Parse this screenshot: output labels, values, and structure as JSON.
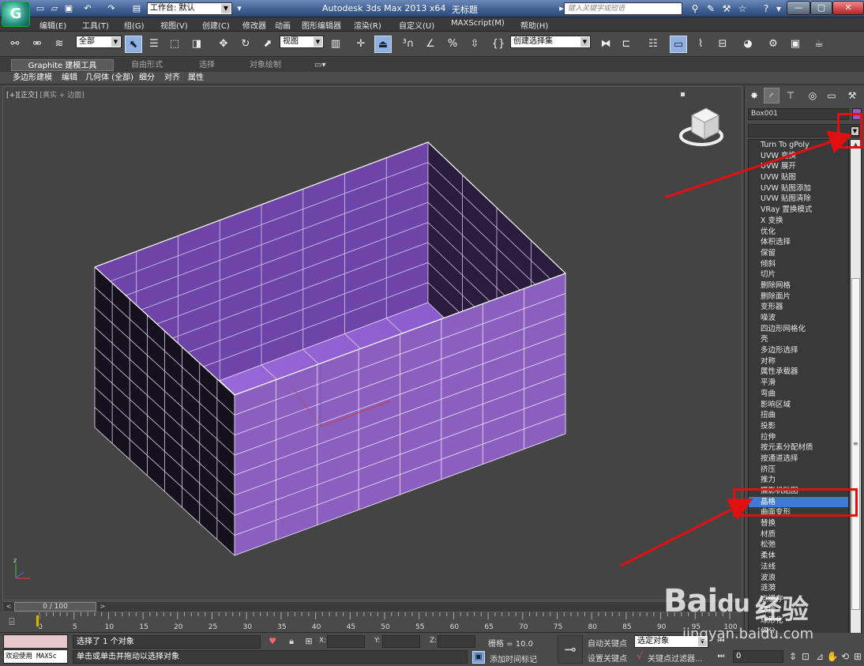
{
  "titlebar": {
    "workspace": "工作台: 默认",
    "app_title": "Autodesk 3ds Max  2013 x64",
    "file_name": "无标题",
    "search_placeholder": "键入关键字或短语"
  },
  "menu": [
    "编辑(E)",
    "工具(T)",
    "组(G)",
    "视图(V)",
    "创建(C)",
    "修改器",
    "动画",
    "图形编辑器",
    "渲染(R)",
    "自定义(U)",
    "MAXScript(M)",
    "帮助(H)"
  ],
  "toolbar": {
    "selection_filter": "全部",
    "reference_coord": "视图",
    "named_selection": "创建选择集"
  },
  "ribbon": {
    "tabs": [
      "Graphite 建模工具",
      "自由形式",
      "选择",
      "对象绘制"
    ],
    "subtabs": [
      "多边形建模",
      "编辑",
      "几何体 (全部)",
      "细分",
      "对齐",
      "属性"
    ]
  },
  "viewport": {
    "label_a": "[+][正交]",
    "label_b": "[真实 + 边面]"
  },
  "command_panel": {
    "object_name": "Box001",
    "object_color": "#9a55cc",
    "modifier_list": [
      "Turn To gPoly",
      "UVW 变换",
      "UVW 展开",
      "UVW 贴图",
      "UVW 贴图添加",
      "UVW 贴图清除",
      "VRay 置换模式",
      "X 变换",
      "优化",
      "体积选择",
      "保留",
      "倾斜",
      "切片",
      "删除网格",
      "删除面片",
      "变形器",
      "噪波",
      "四边形网格化",
      "壳",
      "多边形选择",
      "对称",
      "属性承载器",
      "平滑",
      "弯曲",
      "影响区域",
      "扭曲",
      "投影",
      "拉伸",
      "按元素分配材质",
      "按通道选择",
      "挤压",
      "推力",
      "摄影机贴图",
      "晶格",
      "曲面变形",
      "替换",
      "材质",
      "松弛",
      "柔体",
      "法线",
      "波浪",
      "涟漪",
      "点缓存",
      "焊接",
      "球形化",
      "细分"
    ],
    "selected_index": 33
  },
  "timeline": {
    "frame_display": "0 / 100",
    "ticks": [
      "0",
      "5",
      "10",
      "15",
      "20",
      "25",
      "30",
      "35",
      "40",
      "45",
      "50",
      "55",
      "60",
      "65",
      "70",
      "75",
      "80",
      "85",
      "90",
      "95",
      "100"
    ]
  },
  "status": {
    "welcome": "欢迎使用 MAXSc",
    "selection": "选择了 1 个对象",
    "prompt": "单击或单击并拖动以选择对象",
    "x_label": "X:",
    "y_label": "Y:",
    "z_label": "Z:",
    "grid": "栅格 = 10.0",
    "add_time_tag": "添加时间标记",
    "auto_key": "自动关键点",
    "set_key": "设置关键点",
    "selected_object": "选定对象",
    "key_filters": "关键点过滤器...",
    "frame": "0"
  },
  "watermark": {
    "brand": "Bai",
    "paw": "du",
    "jingyan": "经验",
    "url": "jingyan.baidu.com"
  },
  "colors": {
    "box_light": "#8a5fc0",
    "box_mid": "#6f44a8",
    "box_dark": "#14101c",
    "annotation": "#e01010",
    "selection_blue": "#3f7bd6"
  }
}
